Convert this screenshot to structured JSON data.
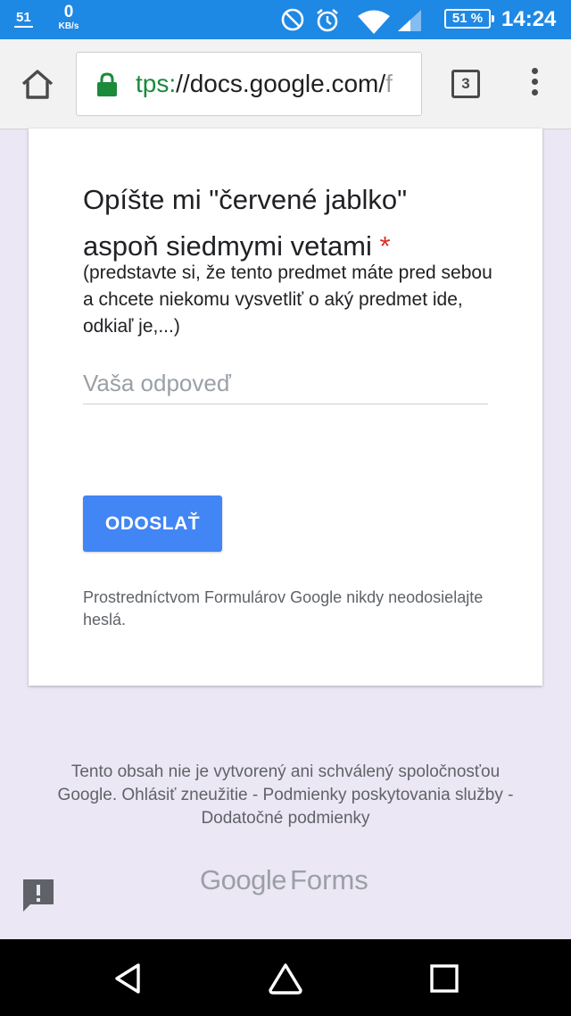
{
  "status_bar": {
    "left_badge": "51",
    "speed_value": "0",
    "speed_unit": "KB/s",
    "battery": "51 %",
    "time": "14:24",
    "icons": [
      "no-disturb-icon",
      "alarm-icon",
      "wifi-icon",
      "signal-icon"
    ]
  },
  "browser": {
    "url_scheme_part": "tps:",
    "url_main": "//docs.google.com/",
    "url_fade": "f",
    "tab_count": "3",
    "icons": [
      "home-icon",
      "lock-icon",
      "more-vert-icon"
    ]
  },
  "form": {
    "question_title": "Opíšte mi \"červené jablko\" aspoň siedmymi vetami",
    "required_marker": "*",
    "question_description": "(predstavte si, že tento predmet máte pred sebou a chcete niekomu vysvetliť o aký predmet ide, odkiaľ je,...)",
    "answer_placeholder": "Vaša odpoveď",
    "submit_label": "ODOSLAŤ",
    "password_warning": "Prostredníctvom Formulárov Google nikdy neodosielajte heslá."
  },
  "footer": {
    "disclaimer": "Tento obsah nie je vytvorený ani schválený spoločnosťou Google.",
    "report_link": "Ohlásiť zneužitie",
    "separator": " - ",
    "terms_link": "Podmienky poskytovania služby",
    "additional_terms_link": "Dodatočné podmienky",
    "brand_google": "Google",
    "brand_forms": "Forms"
  },
  "colors": {
    "status_bar": "#1e88e5",
    "page_background": "#ece7f5",
    "submit_button": "#4285f4",
    "required": "#d93025",
    "secure_lock": "#1b8a3a"
  }
}
